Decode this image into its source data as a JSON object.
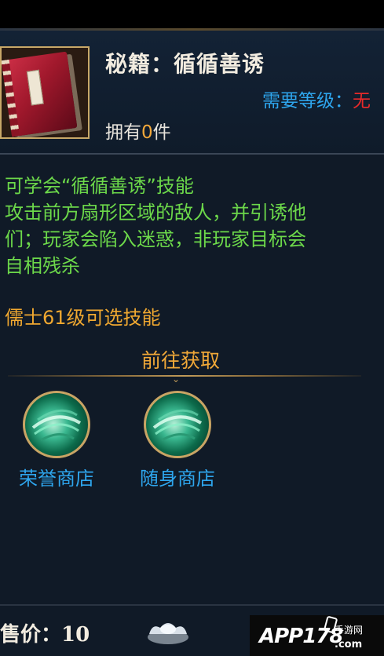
{
  "item": {
    "title": "秘籍：循循善诱",
    "required_level_label": "需要等级：",
    "required_level_value": "无",
    "owned_prefix": "拥有",
    "owned_count": "0",
    "owned_suffix": "件",
    "icon": "red-scroll-book-icon"
  },
  "description": {
    "lines": [
      "可学会“循循善诱”技能",
      "攻击前方扇形区域的敌人，并引诱他",
      "们；玩家会陷入迷惑，非玩家目标会",
      "自相残杀"
    ],
    "class_requirement": "儒士61级可选技能"
  },
  "obtain": {
    "title": "前往获取",
    "sources": [
      {
        "label": "荣誉商店",
        "icon": "green-vortex-icon"
      },
      {
        "label": "随身商店",
        "icon": "green-vortex-icon"
      }
    ]
  },
  "footer": {
    "price_label": "售价：",
    "price_value": "10",
    "currency_icon": "silver-ingot-icon"
  },
  "watermark": {
    "main": "APP178",
    "sub": "手游网",
    "domain": ".com"
  },
  "colors": {
    "green_text": "#6cd84a",
    "blue_text": "#2ea6ee",
    "orange_text": "#f0a830",
    "red_text": "#e82a2a"
  }
}
